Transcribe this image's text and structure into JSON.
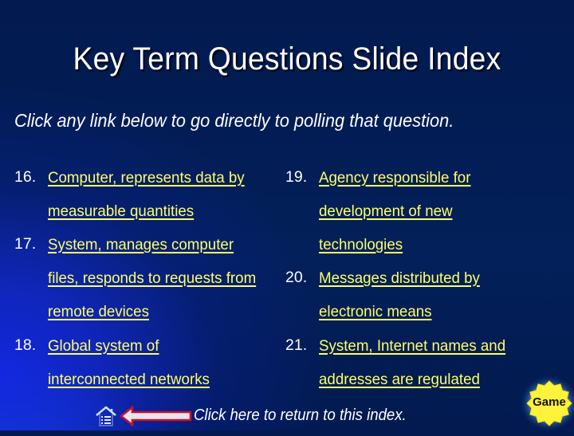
{
  "title": "Key Term Questions Slide Index",
  "subtitle": "Click any link below to go directly to polling that question.",
  "colors": {
    "background_dark": "#021a4f",
    "background_glow": "#1428e6",
    "link": "#ffff66",
    "text": "#ffffff",
    "game_badge": "#fff23a",
    "arrow_border": "#c8102e",
    "arrow_fill": "#e6e6ee"
  },
  "questions": [
    {
      "number": "16.",
      "lines": [
        "Computer, represents data by",
        "measurable quantities"
      ]
    },
    {
      "number": "17.",
      "lines": [
        "System, manages computer",
        "files, responds to requests from",
        "remote devices"
      ]
    },
    {
      "number": "18.",
      "lines": [
        "Global system of",
        "interconnected networks"
      ]
    },
    {
      "number": "19.",
      "lines": [
        "Agency responsible for",
        "development of new",
        "technologies"
      ]
    },
    {
      "number": "20.",
      "lines": [
        "Messages distributed by",
        "electronic means"
      ]
    },
    {
      "number": "21.",
      "lines": [
        "System, Internet names and",
        "addresses are regulated"
      ]
    }
  ],
  "footer": {
    "home_icon": "home-icon",
    "arrow_icon": "left-arrow-icon",
    "text": "Click here to return to this index."
  },
  "game_button": {
    "label": "Game",
    "icon": "starburst-badge"
  }
}
